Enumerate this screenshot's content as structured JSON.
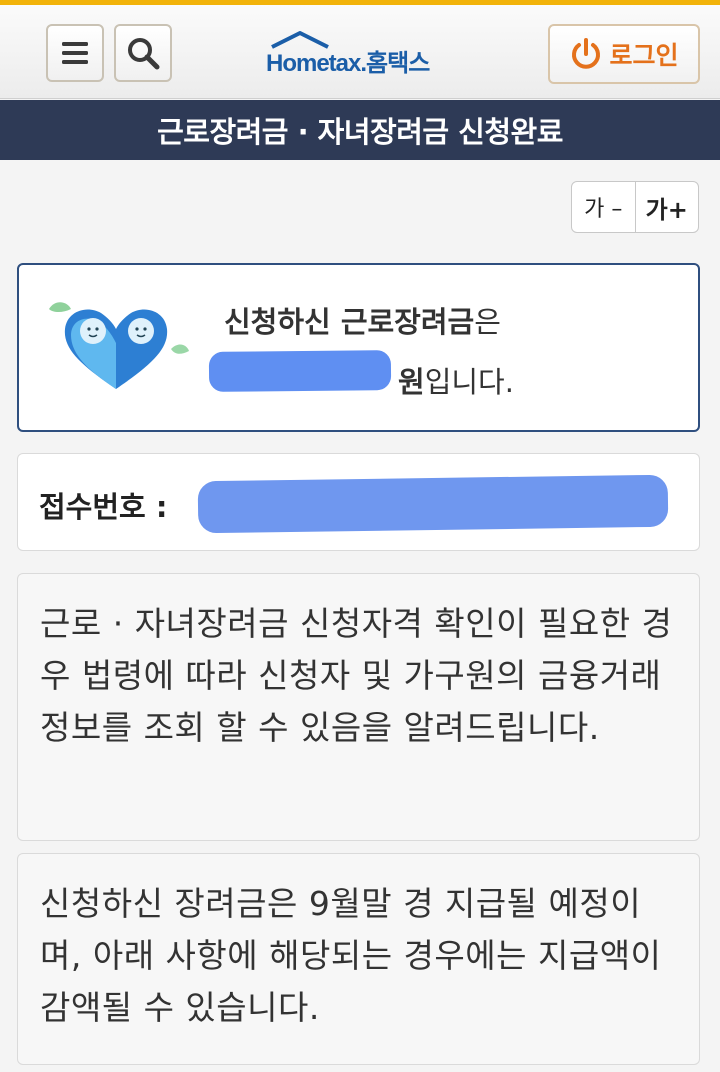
{
  "header": {
    "logo_brand": "Hometax.",
    "logo_kor": "홈택스",
    "menu_icon": "hamburger-menu-icon",
    "search_icon": "search-icon",
    "login_icon": "power-icon",
    "login_label": "로그인"
  },
  "page_title": "근로장려금 · 자녀장려금 신청완료",
  "font_controls": {
    "decrease": "가 –",
    "increase": "가+"
  },
  "amount": {
    "line1_bold": "신청하신 근로장려금",
    "line1_rest": "은",
    "unit_bold": "원",
    "line2_rest": "입니다.",
    "mascot_icon": "heart-mascot-icon"
  },
  "receipt": {
    "label": "접수번호 :"
  },
  "notices": [
    "근로 · 자녀장려금 신청자격 확인이 필요한 경우 법령에 따라 신청자 및 가구원의 금융거래정보를 조회 할 수 있음을 알려드립니다.",
    "신청하신 장려금은 9월말 경 지급될 예정이며, 아래 사항에 해당되는 경우에는 지급액이 감액될 수 있습니다."
  ],
  "colors": {
    "accent_orange": "#e4711b",
    "title_bar": "#2e3a56",
    "brand_blue": "#1b5ea8",
    "redaction": "#5f8ff2"
  }
}
